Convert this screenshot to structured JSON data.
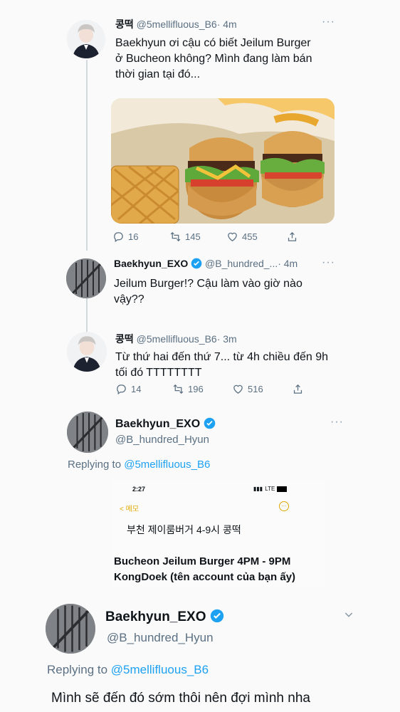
{
  "tweet1": {
    "name": "콩떡",
    "handle": "@5mellifluous_B6",
    "time": "· 4m",
    "text_lines": [
      "Baekhyun ơi cậu có biết Jeilum Burger",
      "ở Bucheon không? Mình đang làm bán",
      "thời gian tại đó..."
    ],
    "replies": "16",
    "retweets": "145",
    "likes": "455"
  },
  "tweet2": {
    "name": "Baekhyun_EXO",
    "handle": "@B_hundred_...",
    "time": "· 4m",
    "text_lines": [
      "Jeilum Burger!? Cậu làm vào giờ nào",
      "vậy??"
    ]
  },
  "tweet3": {
    "name": "콩떡",
    "handle": "@5mellifluous_B6",
    "time": "· 3m",
    "text_lines": [
      "Từ thứ hai đến thứ 7... từ 4h chiều đến 9h",
      "tối đó TTTTTTTT"
    ],
    "replies": "14",
    "retweets": "196",
    "likes": "516"
  },
  "tweet4": {
    "name": "Baekhyun_EXO",
    "handle": "@B_hundred_Hyun",
    "replying_prefix": "Replying to",
    "replying_to": "@5mellifluous_B6",
    "phone_time": "2:27",
    "phone_status": "LTE",
    "memo_back": "< 메모",
    "memo_text": "부천 제이룸버거 4-9시 콩떡",
    "translation_line1": "Bucheon Jeilum Burger 4PM - 9PM",
    "translation_line2": "KongDoek (tên account của bạn ấy)"
  },
  "tweet5": {
    "name": "Baekhyun_EXO",
    "handle": "@B_hundred_Hyun",
    "replying_prefix": "Replying to",
    "replying_to": "@5mellifluous_B6",
    "text": "Mình sẽ đến đó sớm thôi nên đợi mình nha"
  },
  "icons": [
    "reply-icon",
    "retweet-icon",
    "like-icon",
    "share-icon",
    "verified-icon",
    "more-icon",
    "chevron-down-icon"
  ],
  "colors": {
    "twitter_blue": "#1da1f2",
    "muted": "#5b7083",
    "memo_yellow": "#e0a800"
  }
}
